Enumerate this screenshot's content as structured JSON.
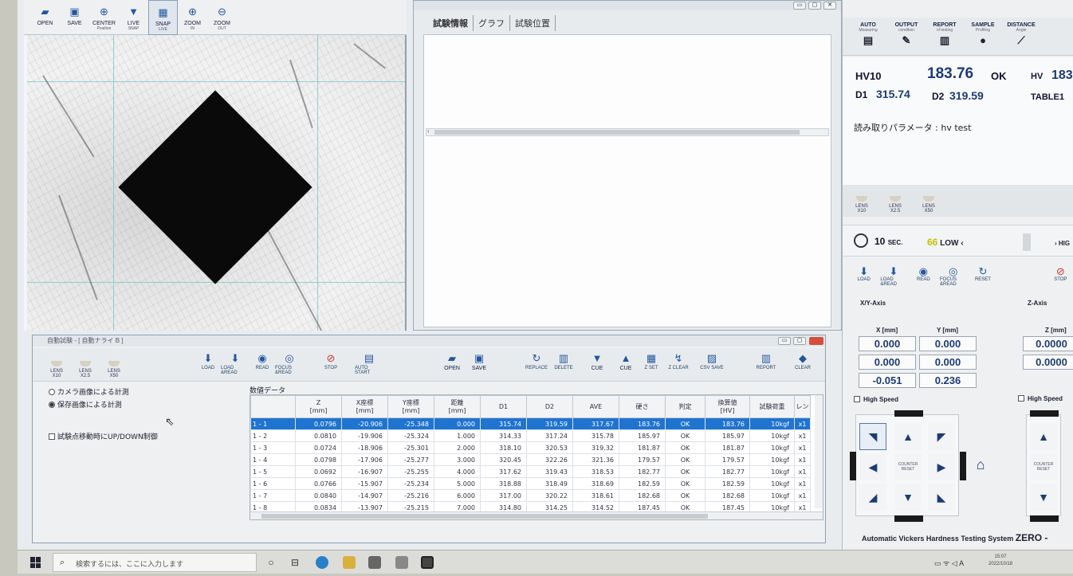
{
  "camera": {
    "toolbar": [
      {
        "label": "OPEN",
        "sub": "",
        "icon": "folder-icon"
      },
      {
        "label": "SAVE",
        "sub": "",
        "icon": "floppy-icon"
      },
      {
        "label": "CENTER",
        "sub": "Position",
        "icon": "crosshair-icon"
      },
      {
        "label": "LIVE",
        "sub": "SNAP",
        "icon": "camera-icon"
      },
      {
        "label": "SNAP",
        "sub": "LIVE",
        "icon": "snapshot-icon"
      },
      {
        "label": "ZOOM",
        "sub": "IN",
        "icon": "zoom-in-icon"
      },
      {
        "label": "ZOOM",
        "sub": "OUT",
        "icon": "zoom-out-icon"
      }
    ]
  },
  "data_window": {
    "tabs": [
      "試験情報",
      "グラフ",
      "試験位置"
    ]
  },
  "right": {
    "toolbar": [
      {
        "label": "AUTO",
        "sub": "Measuring",
        "icon": "auto-measure-icon"
      },
      {
        "label": "OUTPUT",
        "sub": "condition",
        "icon": "output-icon"
      },
      {
        "label": "REPORT",
        "sub": "of testing",
        "icon": "report-icon"
      },
      {
        "label": "SAMPLE",
        "sub": "Profiling",
        "icon": "sample-icon"
      },
      {
        "label": "DISTANCE",
        "sub": "Angle",
        "icon": "distance-icon"
      }
    ],
    "result": {
      "scale": "HV10",
      "value": "183.76",
      "judgement": "OK",
      "hv_label": "HV",
      "hv_value": "183",
      "d1_label": "D1",
      "d1": "315.74",
      "d2_label": "D2",
      "d2": "319.59",
      "table": "TABLE1",
      "param_label": "読み取りパラメータ",
      "param_value": "hv test"
    },
    "lenses": [
      "X10",
      "X2.5",
      "X50"
    ],
    "lens_prefix": "LENS",
    "timer": {
      "value": "10",
      "unit": "SEC.",
      "speed_num": "66",
      "low": "LOW",
      "high": "HIG"
    },
    "actions": [
      {
        "label": "LOAD",
        "icon": "load-icon"
      },
      {
        "label": "LOAD &READ",
        "icon": "load-read-icon"
      },
      {
        "label": "READ",
        "icon": "read-icon"
      },
      {
        "label": "FOCUS &READ",
        "icon": "focus-read-icon"
      },
      {
        "label": "RESET",
        "icon": "reset-icon"
      },
      {
        "label": "STOP",
        "icon": "stop-icon"
      }
    ],
    "xy_axis_label": "X/Y-Axis",
    "z_axis_label": "Z-Axis",
    "x_col": "X [mm]",
    "y_col": "Y [mm]",
    "z_col": "Z [mm]",
    "coords": {
      "x1": "0.000",
      "y1": "0.000",
      "x2": "0.000",
      "y2": "0.000",
      "x3": "-0.051",
      "y3": "0.236",
      "z1": "0.0000",
      "z2": "0.0000"
    },
    "high_speed": "High Speed",
    "counter_reset": "COUNTER RESET",
    "brand": "Automatic Vickers Hardness Testing System",
    "brand_name": "ZERO -"
  },
  "auto": {
    "title": "自動試験 - [ 自動ナライ B ]",
    "lenses": [
      "X10",
      "X2.5",
      "X50"
    ],
    "toolbar": [
      {
        "label": "LOAD",
        "icon": "load-icon"
      },
      {
        "label": "LOAD &READ",
        "icon": "load-read-icon"
      },
      {
        "label": "READ",
        "icon": "read-icon"
      },
      {
        "label": "FOCUS &READ",
        "icon": "focus-read-icon"
      },
      {
        "label": "STOP",
        "icon": "stop-icon"
      },
      {
        "label": "AUTO START",
        "icon": "auto-start-icon"
      },
      {
        "label": "OPEN",
        "icon": "folder-icon"
      },
      {
        "label": "SAVE",
        "icon": "floppy-icon"
      },
      {
        "label": "REPLACE",
        "icon": "replace-icon"
      },
      {
        "label": "DELETE",
        "icon": "trash-icon"
      },
      {
        "label": "CUE",
        "icon": "cue-down-icon"
      },
      {
        "label": "CUE",
        "icon": "cue-up-icon"
      },
      {
        "label": "Z SET",
        "icon": "z-set-icon"
      },
      {
        "label": "Z CLEAR",
        "icon": "z-clear-icon"
      },
      {
        "label": "CSV SAVE",
        "icon": "csv-save-icon"
      },
      {
        "label": "REPORT",
        "icon": "report-icon"
      },
      {
        "label": "CLEAR",
        "icon": "eraser-icon"
      }
    ],
    "options": {
      "radio1": "カメラ画像による計測",
      "radio2": "保存画像による計測",
      "check1": "試験点移動時にUP/DOWN制御"
    },
    "table_title": "数値データ",
    "columns": [
      "",
      "Z\n[mm]",
      "X座標\n[mm]",
      "Y座標\n[mm]",
      "距離\n[mm]",
      "D1",
      "D2",
      "AVE",
      "硬さ",
      "判定",
      "換算値\n[HV]",
      "試験荷重",
      "レン"
    ],
    "rows": [
      [
        "1 - 1",
        "0.0796",
        "-20.906",
        "-25.348",
        "0.000",
        "315.74",
        "319.59",
        "317.67",
        "183.76",
        "OK",
        "183.76",
        "10kgf",
        "x1"
      ],
      [
        "1 - 2",
        "0.0810",
        "-19.906",
        "-25.324",
        "1.000",
        "314.33",
        "317.24",
        "315.78",
        "185.97",
        "OK",
        "185.97",
        "10kgf",
        "x1"
      ],
      [
        "1 - 3",
        "0.0724",
        "-18.906",
        "-25.301",
        "2.000",
        "318.10",
        "320.53",
        "319.32",
        "181.87",
        "OK",
        "181.87",
        "10kgf",
        "x1"
      ],
      [
        "1 - 4",
        "0.0798",
        "-17.906",
        "-25.277",
        "3.000",
        "320.45",
        "322.26",
        "321.36",
        "179.57",
        "OK",
        "179.57",
        "10kgf",
        "x1"
      ],
      [
        "1 - 5",
        "0.0692",
        "-16.907",
        "-25.255",
        "4.000",
        "317.62",
        "319.43",
        "318.53",
        "182.77",
        "OK",
        "182.77",
        "10kgf",
        "x1"
      ],
      [
        "1 - 6",
        "0.0766",
        "-15.907",
        "-25.234",
        "5.000",
        "318.88",
        "318.49",
        "318.69",
        "182.59",
        "OK",
        "182.59",
        "10kgf",
        "x1"
      ],
      [
        "1 - 7",
        "0.0840",
        "-14.907",
        "-25.216",
        "6.000",
        "317.00",
        "320.22",
        "318.61",
        "182.68",
        "OK",
        "182.68",
        "10kgf",
        "x1"
      ],
      [
        "1 - 8",
        "0.0834",
        "-13.907",
        "-25.215",
        "7.000",
        "314.80",
        "314.25",
        "314.52",
        "187.45",
        "OK",
        "187.45",
        "10kgf",
        "x1"
      ]
    ]
  },
  "taskbar": {
    "search_placeholder": "検索するには、ここに入力します",
    "clock": "15:07",
    "date": "2022/10/18"
  }
}
